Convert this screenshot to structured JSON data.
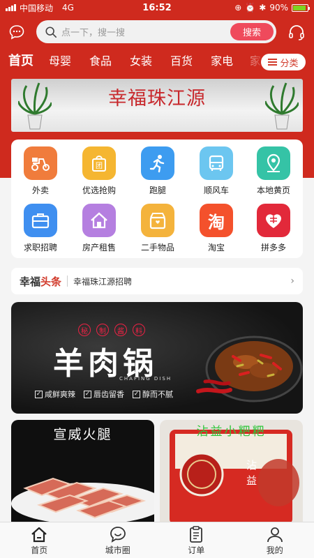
{
  "status_bar": {
    "carrier": "中国移动",
    "network": "4G",
    "time": "16:52",
    "battery": "90%"
  },
  "header": {
    "search_placeholder": "点一下，搜一搜",
    "search_button": "搜索"
  },
  "categories": {
    "items": [
      "首页",
      "母婴",
      "食品",
      "女装",
      "百货",
      "家电",
      "家"
    ],
    "active_index": 0,
    "more_label": "分类"
  },
  "banner": {
    "title": "幸福珠江源"
  },
  "services": [
    {
      "label": "外卖",
      "color": "#f07c3c",
      "icon": "scooter-icon"
    },
    {
      "label": "优选抢购",
      "color": "#f5b631",
      "icon": "shopping-bag-icon"
    },
    {
      "label": "跑腿",
      "color": "#3d9cf0",
      "icon": "runner-icon"
    },
    {
      "label": "顺风车",
      "color": "#6cc6f0",
      "icon": "car-icon"
    },
    {
      "label": "本地黄页",
      "color": "#35c3a6",
      "icon": "location-pin-icon"
    },
    {
      "label": "求职招聘",
      "color": "#3f8ff0",
      "icon": "briefcase-icon"
    },
    {
      "label": "房产租售",
      "color": "#b57fe0",
      "icon": "house-icon"
    },
    {
      "label": "二手物品",
      "color": "#f4b33c",
      "icon": "box-icon"
    },
    {
      "label": "淘宝",
      "color": "#f4512c",
      "icon": "taobao-icon",
      "glyph": "淘"
    },
    {
      "label": "拼多多",
      "color": "#e2293a",
      "icon": "pinduoduo-icon"
    }
  ],
  "headline": {
    "brand_a": "幸福",
    "brand_b": "头条",
    "text": "幸福珠江源招聘"
  },
  "ad": {
    "tag_chars": [
      "秘",
      "制",
      "酱",
      "料"
    ],
    "title": "羊肉锅",
    "subtitle": "CHAFING DISH",
    "features": [
      "咸鲜爽辣",
      "唇齿留香",
      "醇而不腻"
    ]
  },
  "products": [
    {
      "title": "宣威火腿"
    },
    {
      "title": "沾益小粑粑"
    }
  ],
  "tabbar": {
    "items": [
      {
        "label": "首页",
        "icon": "home-icon"
      },
      {
        "label": "城市圈",
        "icon": "chat-bubble-icon"
      },
      {
        "label": "订单",
        "icon": "clipboard-icon"
      },
      {
        "label": "我的",
        "icon": "user-icon"
      }
    ]
  }
}
